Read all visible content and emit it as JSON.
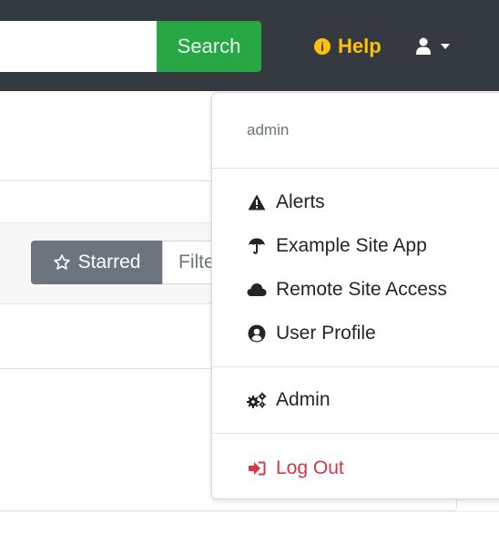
{
  "navbar": {
    "search_label": "Search",
    "help_label": "Help"
  },
  "page": {
    "starred_label": "Starred",
    "filter_placeholder": "Filter"
  },
  "user_menu": {
    "username": "admin",
    "items": [
      {
        "label": "Alerts",
        "icon": "alert-triangle-icon"
      },
      {
        "label": "Example Site App",
        "icon": "umbrella-icon"
      },
      {
        "label": "Remote Site Access",
        "icon": "cloud-icon"
      },
      {
        "label": "User Profile",
        "icon": "user-circle-icon"
      }
    ],
    "admin_label": "Admin",
    "logout_label": "Log Out"
  },
  "colors": {
    "navbar_bg": "#343a40",
    "search_button": "#28a745",
    "help": "#ffc107",
    "logout": "#dc3545",
    "starred_button": "#6c757d"
  }
}
